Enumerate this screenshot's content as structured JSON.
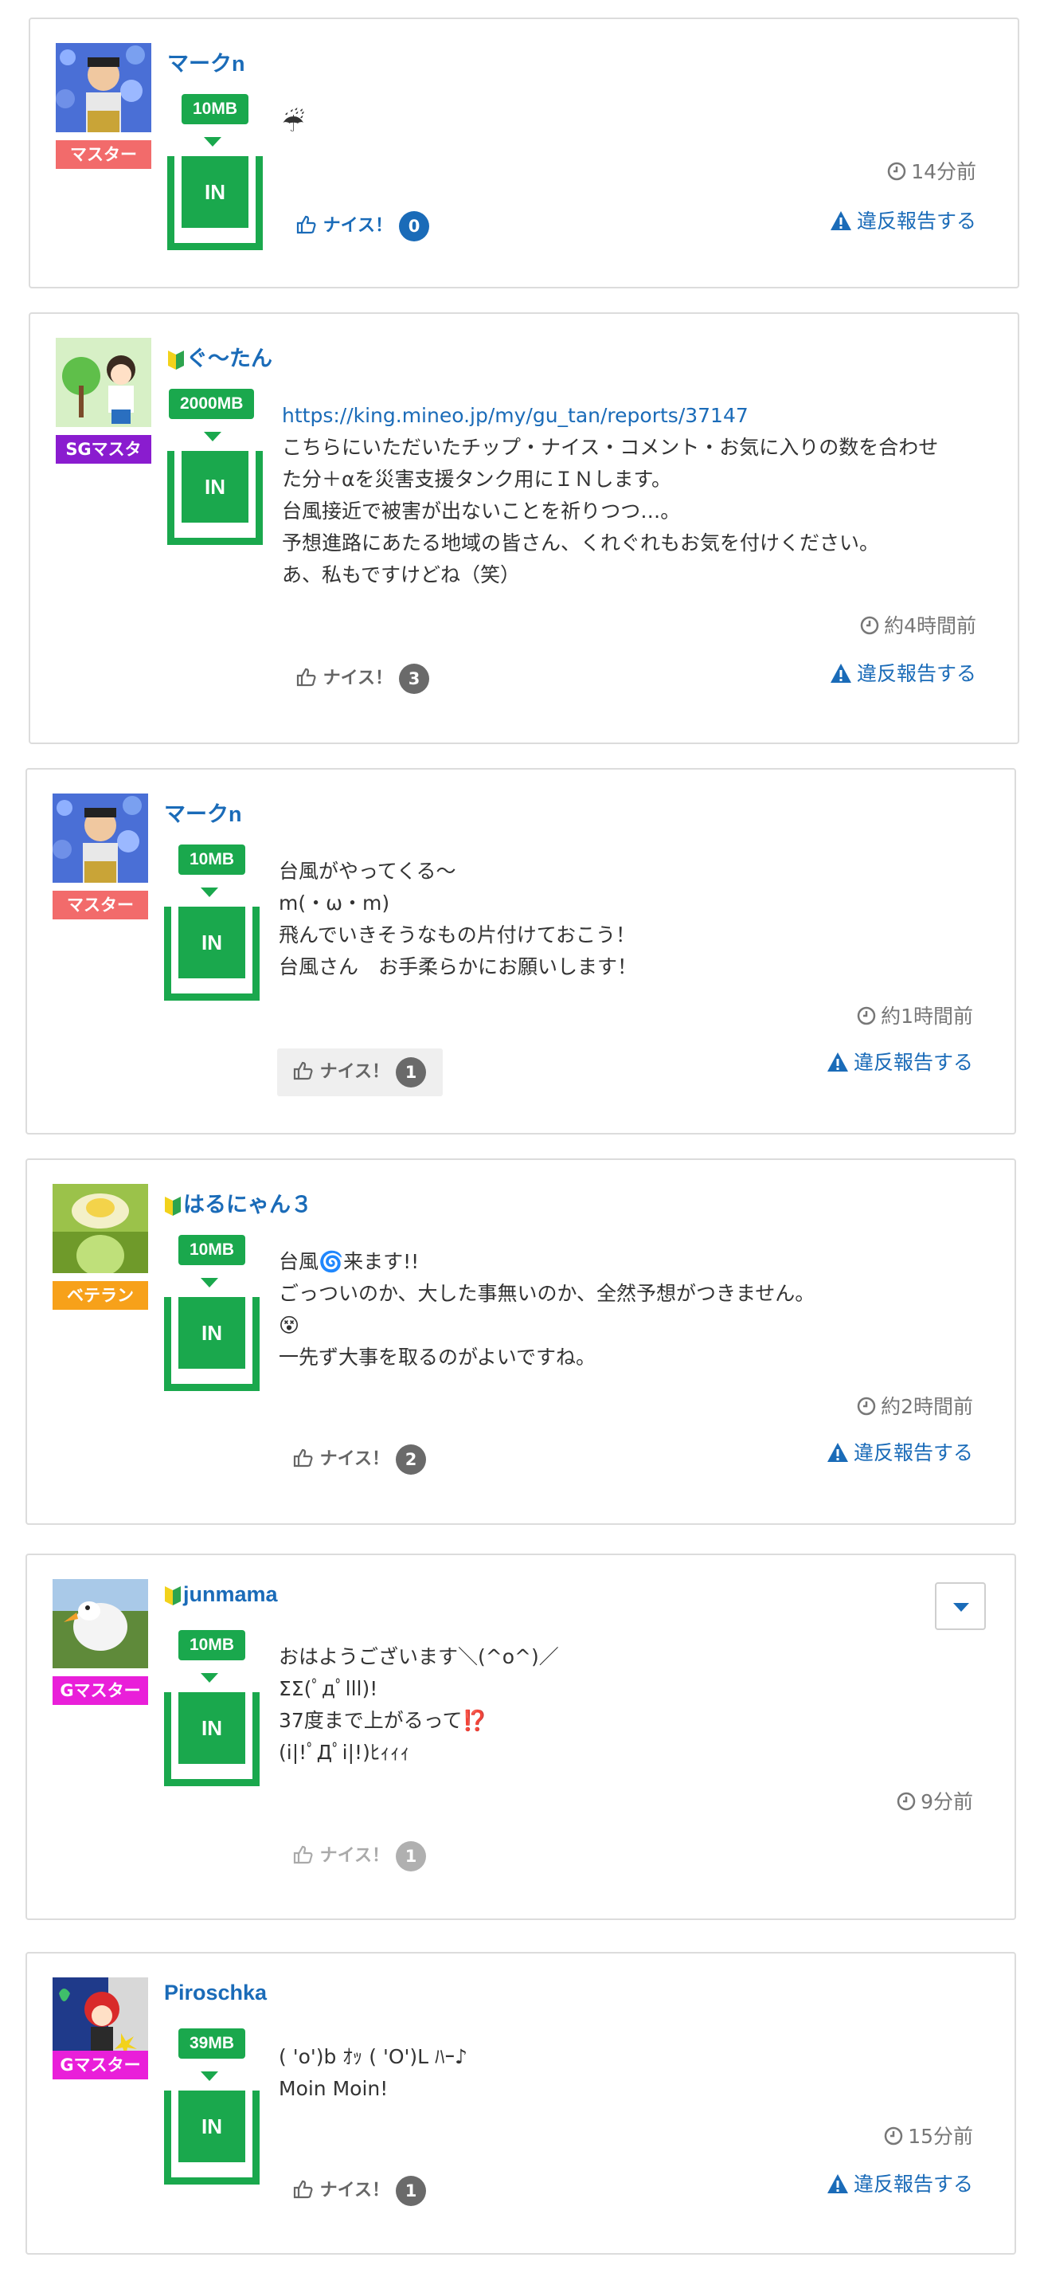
{
  "colors": {
    "link": "#1a6bb8",
    "tank_green": "#1aa84d",
    "role_master": "#f26b6b",
    "role_sgmaster": "#8a1ccf",
    "role_veteran": "#f7a11a",
    "role_gmaster": "#e91fd9",
    "count_active_blue": "#1a6bb8",
    "count_dark": "#6a6a6a",
    "count_light": "#b0b0b0"
  },
  "posts": [
    {
      "username": "マークn",
      "beginner": false,
      "role": "マスター",
      "badge": "10MB",
      "tank_label": "IN",
      "message": [
        "☔"
      ],
      "time": "14分前",
      "nice_label": "ナイス！",
      "nice_count": "0",
      "report_label": "違反報告する",
      "avatar_icon": "avatar-man-flowers"
    },
    {
      "username": "ぐ〜たん",
      "beginner": true,
      "role": "SGマスタ",
      "badge": "2000MB",
      "tank_label": "IN",
      "link": "https://king.mineo.jp/my/gu_tan/reports/37147",
      "message": [
        "こちらにいただいたチップ・ナイス・コメント・お気に入りの数を合わせ",
        "た分＋αを災害支援タンク用にＩＮします。",
        "台風接近で被害が出ないことを祈りつつ…。",
        "予想進路にあたる地域の皆さん、くれぐれもお気を付けください。",
        "あ、私もですけどね（笑）"
      ],
      "time": "約4時間前",
      "nice_label": "ナイス！",
      "nice_count": "3",
      "report_label": "違反報告する",
      "avatar_icon": "avatar-green-project"
    },
    {
      "username": "マークn",
      "beginner": false,
      "role": "マスター",
      "badge": "10MB",
      "tank_label": "IN",
      "message": [
        "台風がやってくる〜",
        "m(・ω・m)",
        "飛んでいきそうなもの片付けておこう！",
        "台風さん　お手柔らかにお願いします！"
      ],
      "time": "約1時間前",
      "nice_label": "ナイス！",
      "nice_count": "1",
      "report_label": "違反報告する",
      "avatar_icon": "avatar-man-flowers"
    },
    {
      "username": "はるにゃん３",
      "beginner": true,
      "role": "ベテラン",
      "badge": "10MB",
      "tank_label": "IN",
      "message": [
        "台風🌀来ます!!",
        "ごっついのか、大した事無いのか、全然予想がつきません。",
        "😵",
        "一先ず大事を取るのがよいですね。"
      ],
      "time": "約2時間前",
      "nice_label": "ナイス！",
      "nice_count": "2",
      "report_label": "違反報告する",
      "avatar_icon": "avatar-flower-bud"
    },
    {
      "username": "junmama",
      "beginner": true,
      "role": "Gマスター",
      "badge": "10MB",
      "tank_label": "IN",
      "message": [
        "おはようございます＼(^o^)／",
        "ΣΣ(ﾟдﾟlll)!",
        "37度まで上がるって⁉️",
        "(i|!ﾟДﾟi|!)ﾋｨｨｨ"
      ],
      "time": "9分前",
      "nice_label": "ナイス！",
      "nice_count": "1",
      "avatar_icon": "avatar-goose"
    },
    {
      "username": "Piroschka",
      "beginner": false,
      "role": "Gマスター",
      "badge": "39MB",
      "tank_label": "IN",
      "message": [
        "( 'o')b ｵｯ ( 'O')L ﾊｰ♪",
        "Moin Moin!"
      ],
      "time": "15分前",
      "nice_label": "ナイス！",
      "nice_count": "1",
      "report_label": "違反報告する",
      "avatar_icon": "avatar-cartoon"
    }
  ]
}
